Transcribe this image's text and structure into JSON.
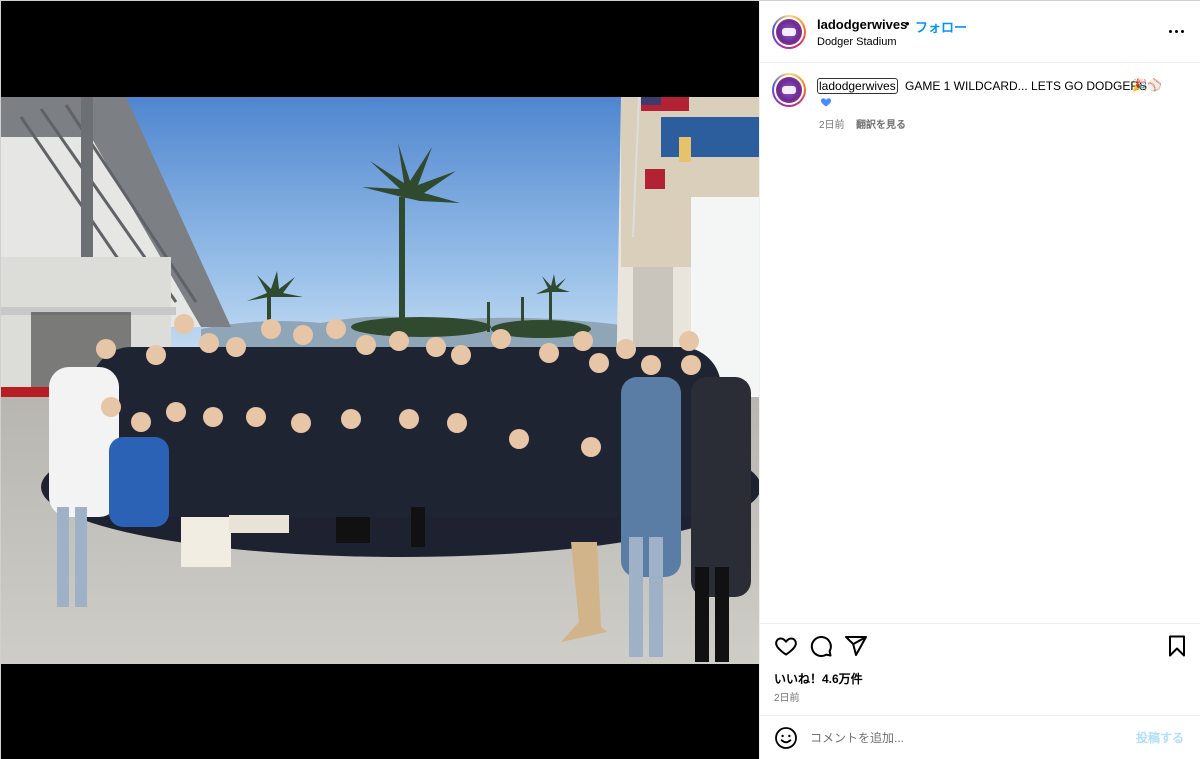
{
  "header": {
    "username": "ladodgerwives",
    "separator": "•",
    "follow_label": "フォロー",
    "location": "Dodger Stadium",
    "more_icon": "more-horizontal-icon"
  },
  "caption": {
    "username": "ladodgerwives",
    "text": "GAME 1 WILDCARD... LETS GO DODGERS",
    "emojis": "🎉⚾",
    "heart_icon": "blue-heart-icon",
    "time": "2日前",
    "translate_label": "翻訳を見る"
  },
  "actions": {
    "like_icon": "heart-outline-icon",
    "comment_icon": "comment-icon",
    "share_icon": "share-icon",
    "save_icon": "bookmark-icon",
    "likes_text": "いいね！4.6万件",
    "time": "2日前"
  },
  "comment_bar": {
    "emoji_icon": "smiley-icon",
    "placeholder": "コメントを追加...",
    "post_label": "投稿する"
  },
  "colors": {
    "accent": "#0095f6",
    "muted": "#737373",
    "post_button_disabled": "#b2dffc",
    "sky_top": "#4f86cf",
    "sky_bottom": "#dceaf6"
  }
}
